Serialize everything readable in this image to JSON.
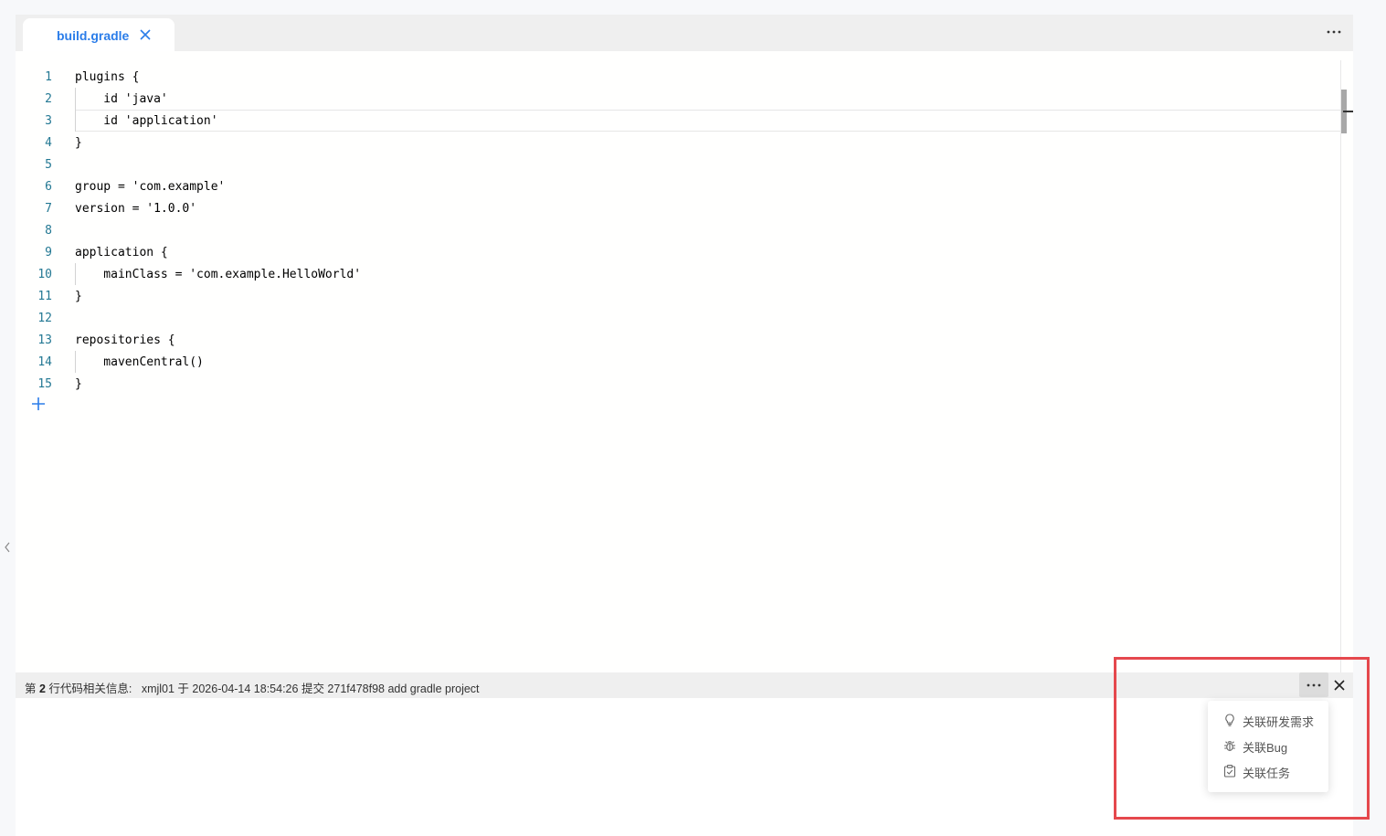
{
  "tab": {
    "filename": "build.gradle"
  },
  "editor": {
    "line_numbers": [
      "1",
      "2",
      "3",
      "4",
      "5",
      "6",
      "7",
      "8",
      "9",
      "10",
      "11",
      "12",
      "13",
      "14",
      "15"
    ],
    "lines": [
      "plugins {",
      "    id 'java'",
      "    id 'application'",
      "}",
      "",
      "group = 'com.example'",
      "version = '1.0.0'",
      "",
      "application {",
      "    mainClass = 'com.example.HelloWorld'",
      "}",
      "",
      "repositories {",
      "    mavenCentral()",
      "}"
    ]
  },
  "infobar": {
    "prefix": "第 ",
    "line_no": "2",
    "middle": " 行代码相关信息:   ",
    "author": "xmjl01",
    "at": " 于 ",
    "datetime": "2026-04-14 18:54:26",
    "commit_word": " 提交 ",
    "commit_hash": "271f478f98",
    "message": " add gradle project"
  },
  "dropdown": {
    "items": [
      {
        "label": "关联研发需求",
        "icon": "lightbulb-icon"
      },
      {
        "label": "关联Bug",
        "icon": "bug-icon"
      },
      {
        "label": "关联任务",
        "icon": "task-check-icon"
      }
    ]
  },
  "colors": {
    "accent": "#2b7de9",
    "line_number": "#237893",
    "highlight": "#e5484d"
  }
}
